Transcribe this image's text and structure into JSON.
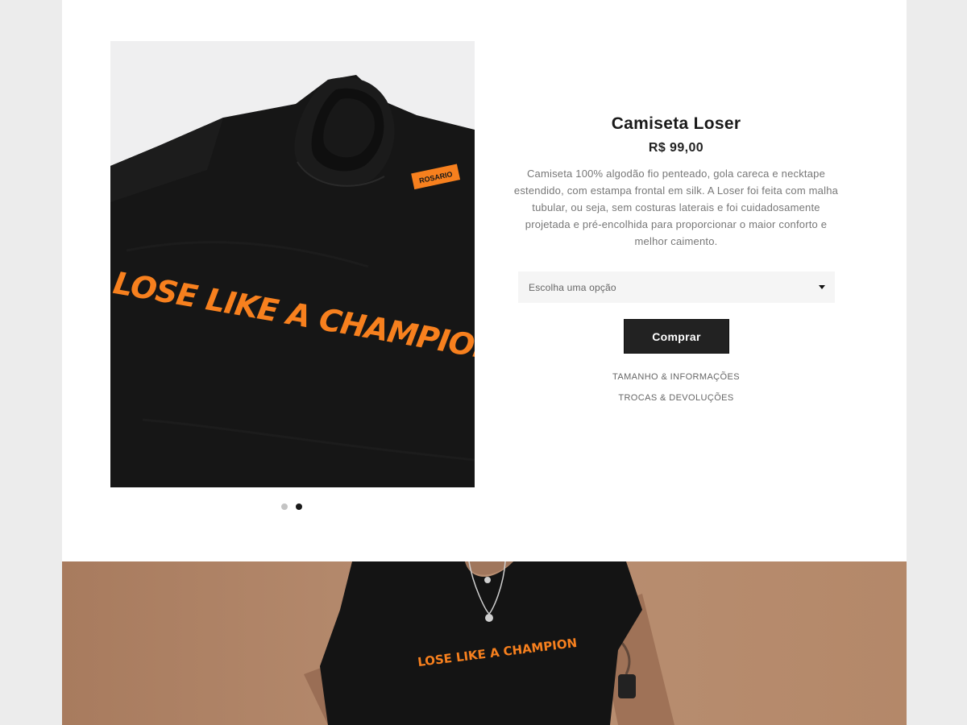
{
  "product": {
    "title": "Camiseta Loser",
    "price": "R$ 99,00",
    "description": "Camiseta 100% algodão fio penteado, gola careca e necktape estendido, com estampa frontal em silk. A Loser foi feita com malha tubular, ou seja, sem costuras laterais e foi cuidadosamente projetada e pré-encolhida para proporcionar o maior conforto e melhor caimento.",
    "select_placeholder": "Escolha uma opção",
    "buy_label": "Comprar",
    "links": [
      "TAMANHO & INFORMAÇÕES",
      "TROCAS & DEVOLUÇÕES"
    ]
  },
  "gallery": {
    "print_text": "LOSE LIKE A CHAMPION",
    "label_text": "ROSARIO",
    "dots": [
      {
        "active": false
      },
      {
        "active": true
      }
    ]
  },
  "lifestyle": {
    "print_text": "LOSE LIKE A CHAMPION"
  },
  "colors": {
    "accent_orange": "#f7801e",
    "shirt_black": "#161616",
    "button_bg": "#222222",
    "background_gray": "#ececec",
    "lifestyle_bg": "#b58a6c"
  }
}
